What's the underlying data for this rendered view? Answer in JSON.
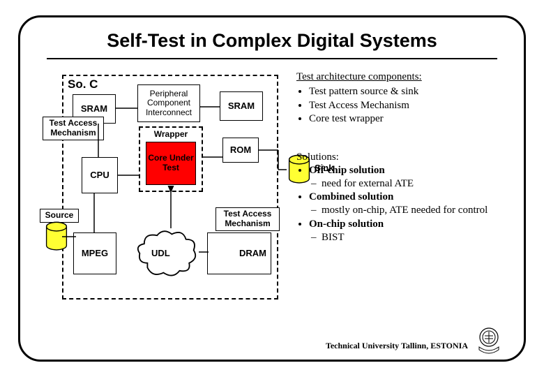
{
  "title": "Self-Test in Complex Digital Systems",
  "soc_label": "So. C",
  "blocks": {
    "sram1": "SRAM",
    "pci": "Peripheral Component Interconnect",
    "sram2": "SRAM",
    "cpu": "CPU",
    "rom": "ROM",
    "mpeg": "MPEG",
    "udl": "UDL",
    "dram": "DRAM",
    "wrapper": "Wrapper",
    "core": "Core Under Test"
  },
  "overlays": {
    "tam1": "Test Access Mechanism",
    "tam2": "Test Access Mechanism",
    "source": "Source",
    "sink": "Sink"
  },
  "arch_heading": "Test architecture components:",
  "arch_items": [
    "Test pattern source & sink",
    "Test Access Mechanism",
    "Core test wrapper"
  ],
  "sol_heading": "Solutions:",
  "solutions": [
    {
      "label": "Off-chip solution",
      "sub": [
        "need for external ATE"
      ]
    },
    {
      "label": "Combined solution",
      "sub": [
        "mostly on-chip, ATE needed for control"
      ]
    },
    {
      "label": "On-chip solution",
      "sub": [
        "BIST"
      ]
    }
  ],
  "footer": "Technical University Tallinn, ESTONIA"
}
